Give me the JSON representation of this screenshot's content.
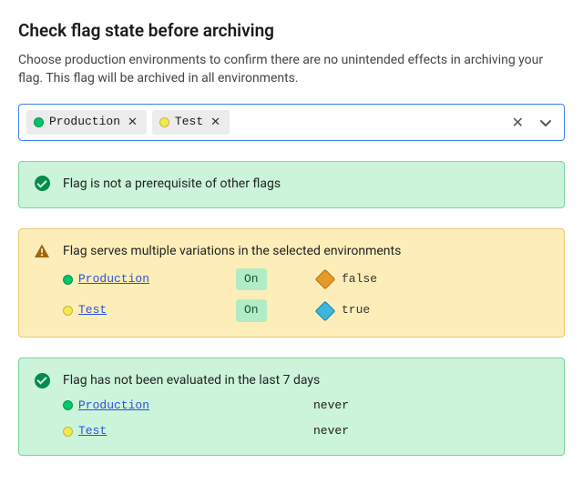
{
  "header": {
    "title": "Check flag state before archiving",
    "description": "Choose production environments to confirm there are no unintended effects in archiving your flag. This flag will be archived in all environments."
  },
  "env_select": {
    "chips": [
      {
        "label": "Production",
        "dot": "green"
      },
      {
        "label": "Test",
        "dot": "yellow"
      }
    ]
  },
  "cards": [
    {
      "status": "success",
      "title": "Flag is not a prerequisite of other flags",
      "layout": "simple"
    },
    {
      "status": "warning",
      "title": "Flag serves multiple variations in the selected environments",
      "layout": "variations",
      "rows": [
        {
          "env": "Production",
          "dot": "green",
          "targeting": "On",
          "variation_color": "orange",
          "variation_label": "false"
        },
        {
          "env": "Test",
          "dot": "yellow",
          "targeting": "On",
          "variation_color": "blue",
          "variation_label": "true"
        }
      ]
    },
    {
      "status": "success",
      "title": "Flag has not been evaluated in the last 7 days",
      "layout": "evaluation",
      "rows": [
        {
          "env": "Production",
          "dot": "green",
          "value": "never"
        },
        {
          "env": "Test",
          "dot": "yellow",
          "value": "never"
        }
      ]
    }
  ]
}
